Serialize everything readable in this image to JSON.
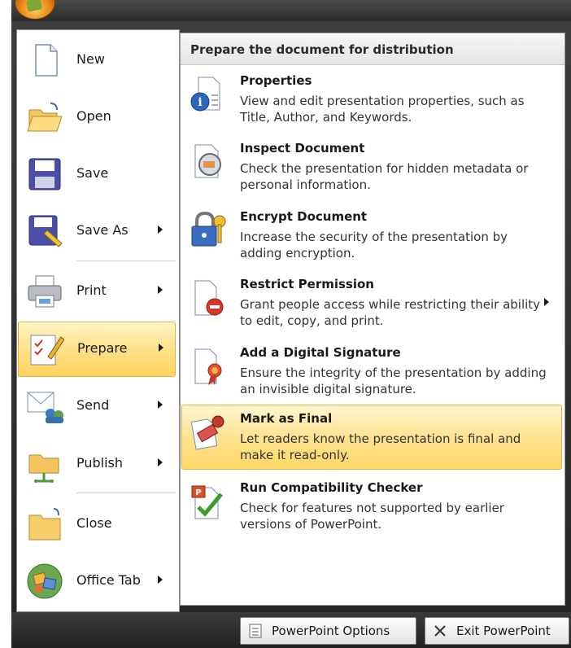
{
  "left_menu": [
    {
      "label": "New",
      "icon": "new-document-icon",
      "has_submenu": false
    },
    {
      "label": "Open",
      "icon": "open-folder-icon",
      "has_submenu": false
    },
    {
      "label": "Save",
      "icon": "save-disk-icon",
      "has_submenu": false
    },
    {
      "label": "Save As",
      "icon": "save-as-icon",
      "has_submenu": true
    },
    {
      "label": "Print",
      "icon": "printer-icon",
      "has_submenu": true
    },
    {
      "label": "Prepare",
      "icon": "prepare-icon",
      "has_submenu": true,
      "active": true
    },
    {
      "label": "Send",
      "icon": "send-icon",
      "has_submenu": true
    },
    {
      "label": "Publish",
      "icon": "publish-icon",
      "has_submenu": true
    },
    {
      "label": "Close",
      "icon": "close-folder-icon",
      "has_submenu": false
    },
    {
      "label": "Office Tab",
      "icon": "office-tab-icon",
      "has_submenu": true
    }
  ],
  "submenu": {
    "header": "Prepare the document for distribution",
    "items": [
      {
        "title": "Properties",
        "desc": "View and edit presentation properties, such as Title, Author, and Keywords.",
        "icon": "properties-icon"
      },
      {
        "title": "Inspect Document",
        "desc": "Check the presentation for hidden metadata or personal information.",
        "icon": "inspect-document-icon"
      },
      {
        "title": "Encrypt Document",
        "desc": "Increase the security of the presentation by adding encryption.",
        "icon": "encrypt-lock-icon"
      },
      {
        "title": "Restrict Permission",
        "desc": "Grant people access while restricting their ability to edit, copy, and print.",
        "icon": "restrict-permission-icon",
        "has_submenu": true
      },
      {
        "title": "Add a Digital Signature",
        "desc": "Ensure the integrity of the presentation by adding an invisible digital signature.",
        "icon": "digital-signature-icon"
      },
      {
        "title": "Mark as Final",
        "desc": "Let readers know the presentation is final and make it read-only.",
        "icon": "mark-as-final-icon",
        "active": true
      },
      {
        "title": "Run Compatibility Checker",
        "desc": "Check for features not supported by earlier versions of PowerPoint.",
        "icon": "compatibility-checker-icon"
      }
    ]
  },
  "footer": {
    "options_label": "PowerPoint Options",
    "exit_label": "Exit PowerPoint"
  },
  "colors": {
    "highlight": "#ffd966",
    "menu_frame": "#2f2f2f"
  }
}
